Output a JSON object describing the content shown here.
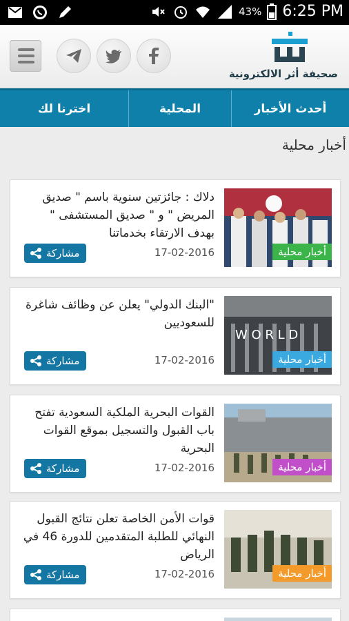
{
  "status_bar": {
    "battery": "43%",
    "time": "6:25 PM",
    "left_icons": [
      "mail-icon",
      "whatsapp-icon",
      "pencil-icon"
    ],
    "right_icons": [
      "mute-icon",
      "alarm-icon",
      "wifi-icon",
      "signal-icon",
      "battery-icon"
    ]
  },
  "header": {
    "logo_text": "صحيفة أثر الالكترونية",
    "social": [
      "facebook-icon",
      "twitter-icon",
      "telegram-icon"
    ],
    "menu_icon": "hamburger-icon"
  },
  "nav": {
    "tabs": [
      {
        "label": "أحدث الأخبار"
      },
      {
        "label": "المحلية"
      },
      {
        "label": "اخترنا لك"
      }
    ]
  },
  "section": {
    "title": "أخبار محلية"
  },
  "articles": [
    {
      "title": "دلاك : جائزتين سنوية باسم \" صديق المريض \" و \" صديق المستشفى \" بهدف الارتقاء بخدماتنا",
      "category": "أخبار محلية",
      "category_color": "#3bb54a",
      "date": "17-02-2016",
      "share_label": "مشاركة"
    },
    {
      "title": "\"البنك الدولي\" يعلن عن وظائف شاغرة للسعوديين",
      "category": "أخبار محلية",
      "category_color": "#3aa9e0",
      "date": "17-02-2016",
      "share_label": "مشاركة"
    },
    {
      "title": "القوات البحرية الملكية السعودية تفتح باب القبول والتسجيل بموقع القوات البحرية",
      "category": "أخبار محلية",
      "category_color": "#c04fc9",
      "date": "17-02-2016",
      "share_label": "مشاركة"
    },
    {
      "title": "قوات الأمن الخاصة تعلن نتائج القبول النهائي للطلبة المتقدمين للدورة 46 في الرياض",
      "category": "أخبار محلية",
      "category_color": "#f39a2b",
      "date": "17-02-2016",
      "share_label": "مشاركة"
    }
  ],
  "colors": {
    "nav_bg": "#0e80a9",
    "share_bg": "#1476a3",
    "page_bg": "#ececec"
  }
}
